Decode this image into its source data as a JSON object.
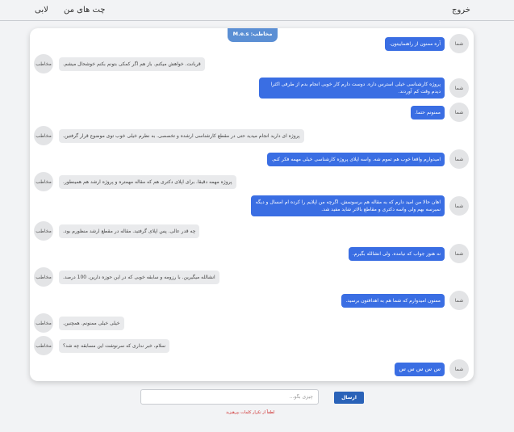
{
  "nav": {
    "exit": "خروج",
    "my_chats": "چت های من",
    "lobby": "لابی"
  },
  "chat": {
    "contact_label": "مخاطب: M.e.s",
    "me_avatar": "شما",
    "other_avatar": "مخاطب",
    "messages": [
      {
        "sender": "me",
        "text": "آره ممنون از راهنماییتون."
      },
      {
        "sender": "other",
        "text": "قربانت. خواهش میکنم. باز هم اگر کمکی بتونم بکنم خوشحال میشم."
      },
      {
        "sender": "me",
        "text": "پروژه کارشناسی خیلی استرس داره. دوست دارم کار خوبی انجام بدم از طرفی اکثرا دیدم وقت کم آوردند."
      },
      {
        "sender": "me",
        "text": "ممنونم حتما."
      },
      {
        "sender": "other",
        "text": "پروژه ای دارید انجام میدید حتی در مقطع کارشناسی ارشده و تخصصی. به نظرم خیلی خوب توی موضوع قرار گرفتین."
      },
      {
        "sender": "me",
        "text": "امیدوارم واقعا خوب هم تموم شه. واسه اپلای پروژه کارشناسی خیلی مهمه فکر کنم."
      },
      {
        "sender": "other",
        "text": "پروژه مهمه دقیقا. برای اپلای دکتری هم که مقاله مهمتره و پروژه ارشد هم همینطور."
      },
      {
        "sender": "me",
        "text": "اهان حالا من امید دارم که به مقاله هم برسونمش. اگرچه من اپلایم را کرده ام امسال و دیگه نمیرسه بهم ولی واسه دکتری و مقاطع بالاتر شاید مفید شد."
      },
      {
        "sender": "other",
        "text": "چه قدر عالی. پس اپلای گرفتید. مقاله در مقطع ارشد منظورم بود."
      },
      {
        "sender": "me",
        "text": "نه هنوز جواب که نیامده. ولی انشالله بگیرم."
      },
      {
        "sender": "other",
        "text": "انشالله میگیرین. با رزومه و سابقه خوبی که در این حوزه دارین. 100 درصد."
      },
      {
        "sender": "me",
        "text": "ممنون امیدوارم که شما هم به اهدافتون برسید."
      },
      {
        "sender": "other",
        "text": "خیلی خیلی ممنونم. همچنین."
      },
      {
        "sender": "other",
        "text": "سلام، خبر نداری که سرنوشت این مسابقه چه شد؟"
      },
      {
        "sender": "me",
        "text": "س س س س س"
      }
    ]
  },
  "composer": {
    "placeholder": "چیزی بگو...",
    "value": "",
    "send_label": "ارسال",
    "warning": "لطفاً از تکرار کلمات بپرهیزید"
  }
}
